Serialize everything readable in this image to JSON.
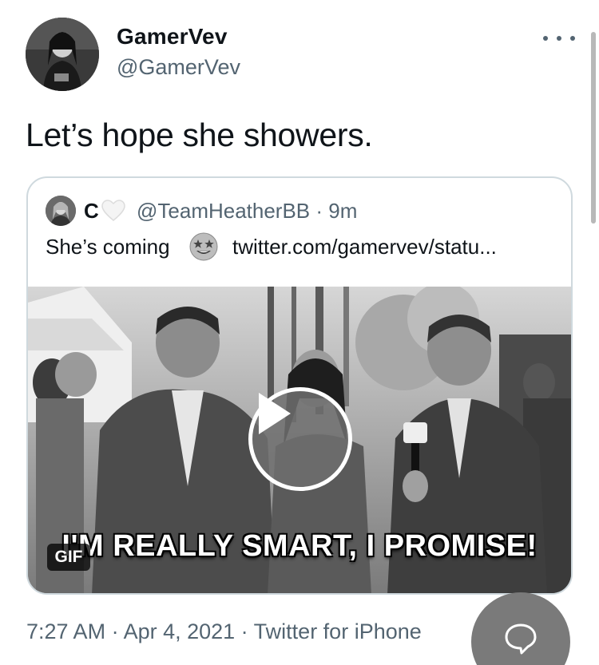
{
  "author": {
    "display_name": "GamerVev",
    "handle": "@GamerVev",
    "avatar_icon": "profile-photo"
  },
  "tweet": {
    "text": "Let’s hope she showers."
  },
  "quoted": {
    "name": "C",
    "heart_icon": "white-heart-emoji",
    "handle_time": "@TeamHeatherBB · 9m",
    "text": "She’s coming",
    "emoji_icon": "star-struck-emoji",
    "link": "twitter.com/gamervev/statu...",
    "media": {
      "caption": "I'M REALLY SMART, I PROMISE!",
      "badge": "GIF",
      "play_icon": "play-icon"
    }
  },
  "meta": {
    "timestamp": "7:27 AM · Apr 4, 2021 · Twitter for iPhone"
  },
  "fab": {
    "icon": "reply-bubble-icon"
  },
  "colors": {
    "text_primary": "#0f1419",
    "text_secondary": "#536471",
    "border": "#cfd9de"
  }
}
